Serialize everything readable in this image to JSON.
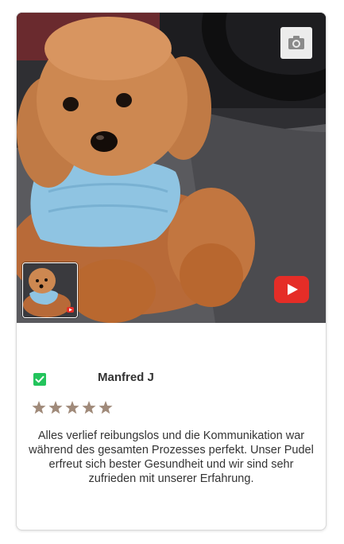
{
  "review": {
    "author": "Manfred J",
    "rating": 5,
    "rating_max": 5,
    "verified": true,
    "text": "Alles verlief reibungslos und die Kommunikation war während des gesamten Prozesses perfekt. Unser Pudel erfreut sich bester Gesundheit und wir sind sehr zufrieden mit unserer Erfahrung."
  },
  "media": {
    "main_image": "toy-poodle-in-blue-sweater-photo",
    "thumbnail": "toy-poodle-thumbnail",
    "camera_icon": "camera-icon",
    "video_icon": "youtube-play-icon"
  },
  "colors": {
    "verified_badge": "#23c45c",
    "star": "#a08a7a",
    "youtube_red": "#e52d27",
    "text": "#333333"
  }
}
